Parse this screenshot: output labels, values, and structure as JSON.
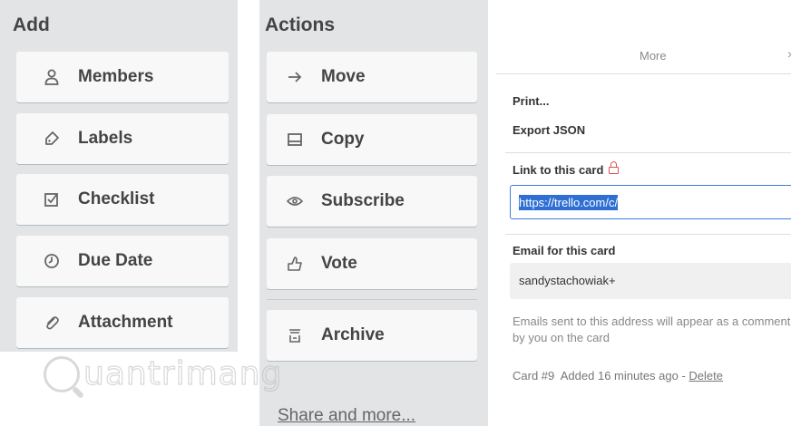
{
  "add": {
    "title": "Add",
    "items": [
      {
        "label": "Members",
        "icon": "person-icon"
      },
      {
        "label": "Labels",
        "icon": "tag-icon"
      },
      {
        "label": "Checklist",
        "icon": "checkbox-icon"
      },
      {
        "label": "Due Date",
        "icon": "clock-icon"
      },
      {
        "label": "Attachment",
        "icon": "paperclip-icon"
      }
    ]
  },
  "actions": {
    "title": "Actions",
    "items": [
      {
        "label": "Move",
        "icon": "arrow-right-icon"
      },
      {
        "label": "Copy",
        "icon": "card-copy-icon"
      },
      {
        "label": "Subscribe",
        "icon": "eye-icon"
      },
      {
        "label": "Vote",
        "icon": "thumbs-up-icon"
      },
      {
        "label": "Archive",
        "icon": "archive-box-icon"
      }
    ],
    "share_link": "Share and more..."
  },
  "more": {
    "title": "More",
    "close": "×",
    "print": "Print...",
    "export_json": "Export JSON",
    "link_label": "Link to this card",
    "link_value": "https://trello.com/c/",
    "email_label": "Email for this card",
    "email_value": "sandystachowiak+",
    "help_text": "Emails sent to this address will appear as a comment by you on the card",
    "card_meta": "Card #9  Added 16 minutes ago - ",
    "delete": "Delete"
  },
  "watermark": {
    "text": "uantrimang"
  },
  "colors": {
    "panel_bg": "#e2e4e6",
    "button_bg": "#f8f8f8",
    "link_highlight": "#2f6fd3",
    "lock_red": "#e05050"
  }
}
